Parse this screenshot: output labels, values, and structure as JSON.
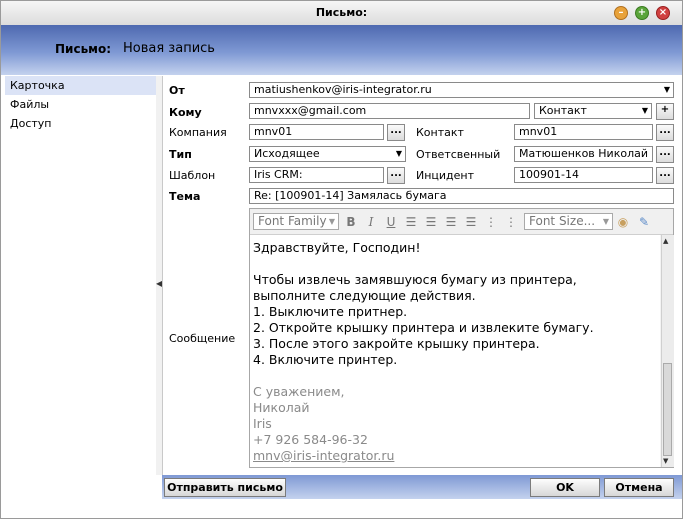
{
  "window": {
    "title": "Письмо:"
  },
  "header": {
    "label": "Письмо:",
    "value": "Новая запись"
  },
  "sidebar": {
    "items": [
      {
        "label": "Карточка",
        "selected": true
      },
      {
        "label": "Файлы",
        "selected": false
      },
      {
        "label": "Доступ",
        "selected": false
      }
    ]
  },
  "form": {
    "from": {
      "label": "От",
      "value": "matiushenkov@iris-integrator.ru"
    },
    "to": {
      "label": "Кому",
      "value": "mnvxxx@gmail.com",
      "type": "Контакт",
      "add": "+"
    },
    "company": {
      "label": "Компания",
      "value": "mnv01"
    },
    "contact": {
      "label": "Контакт",
      "value": "mnv01"
    },
    "type": {
      "label": "Тип",
      "value": "Исходящее"
    },
    "responsible": {
      "label": "Ответсвенный",
      "value": "Матюшенков Николай"
    },
    "template": {
      "label": "Шаблон",
      "value": "Iris CRM:"
    },
    "incident": {
      "label": "Инцидент",
      "value": "100901-14"
    },
    "subject": {
      "label": "Тема",
      "value": "Re: [100901-14] Замялась бумага"
    },
    "message": {
      "label": "Сообщение"
    },
    "dots": "..."
  },
  "editor": {
    "font_family": "Font Family",
    "font_size": "Font Size...",
    "bold": "B",
    "italic": "I",
    "underline": "U",
    "lines": [
      "Здравствуйте, Господин!",
      "",
      "Чтобы извлечь замявшуюся бумагу из принтера,",
      "выполните следующие действия.",
      "1. Выключите притнер.",
      "2. Откройте крышку принтера и извлеките бумагу.",
      "3. После этого закройте крышку принтера.",
      "4. Включите принтер.",
      "",
      "С уважением,",
      "Николай",
      "Iris",
      "+7 926 584-96-32",
      "mnv@iris-integrator.ru"
    ]
  },
  "buttons": {
    "send": "Отправить письмо",
    "ok": "OK",
    "cancel": "Отмена"
  },
  "colors": {
    "header_dark": "#4e69b0",
    "header_light": "#c4d2ee",
    "selection": "#dbe3f6"
  }
}
